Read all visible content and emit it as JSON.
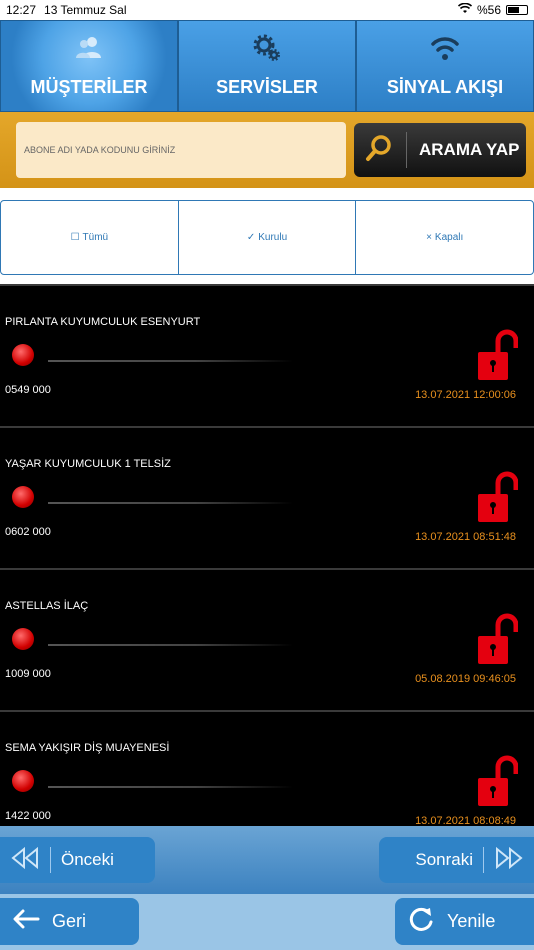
{
  "status": {
    "time": "12:27",
    "date": "13 Temmuz Sal",
    "battery": "%56"
  },
  "tabs": [
    {
      "label": "MÜŞTERİLER",
      "icon": "users-icon",
      "active": true
    },
    {
      "label": "SERVİSLER",
      "icon": "gear-icon",
      "active": false
    },
    {
      "label": "SİNYAL AKIŞI",
      "icon": "wifi-icon",
      "active": false
    }
  ],
  "search": {
    "placeholder": "ABONE ADI YADA KODUNU GİRİNİZ",
    "value": "",
    "button_label": "ARAMA YAP"
  },
  "filters": [
    {
      "label": "Tümü",
      "icon": "checkbox-icon"
    },
    {
      "label": "Kurulu",
      "icon": "check-icon"
    },
    {
      "label": "Kapalı",
      "icon": "x-icon"
    }
  ],
  "subscribers": [
    {
      "name": "PIRLANTA KUYUMCULUK ESENYURT",
      "code": "0549 000",
      "datetime": "13.07.2021 12:00:06"
    },
    {
      "name": "YAŞAR KUYUMCULUK 1 TELSİZ",
      "code": "0602 000",
      "datetime": "13.07.2021 08:51:48"
    },
    {
      "name": "ASTELLAS İLAÇ",
      "code": "1009 000",
      "datetime": "05.08.2019 09:46:05"
    },
    {
      "name": "SEMA YAKIŞIR DİŞ MUAYENESİ",
      "code": "1422 000",
      "datetime": "13.07.2021 08:08:49"
    }
  ],
  "pager": {
    "prev_label": "Önceki",
    "next_label": "Sonraki"
  },
  "bottom": {
    "back_label": "Geri",
    "refresh_label": "Yenile"
  },
  "colors": {
    "accent": "#2f83c7",
    "search_bar": "#d49317",
    "alarm_red": "#e4000f",
    "timestamp": "#e8901e"
  }
}
